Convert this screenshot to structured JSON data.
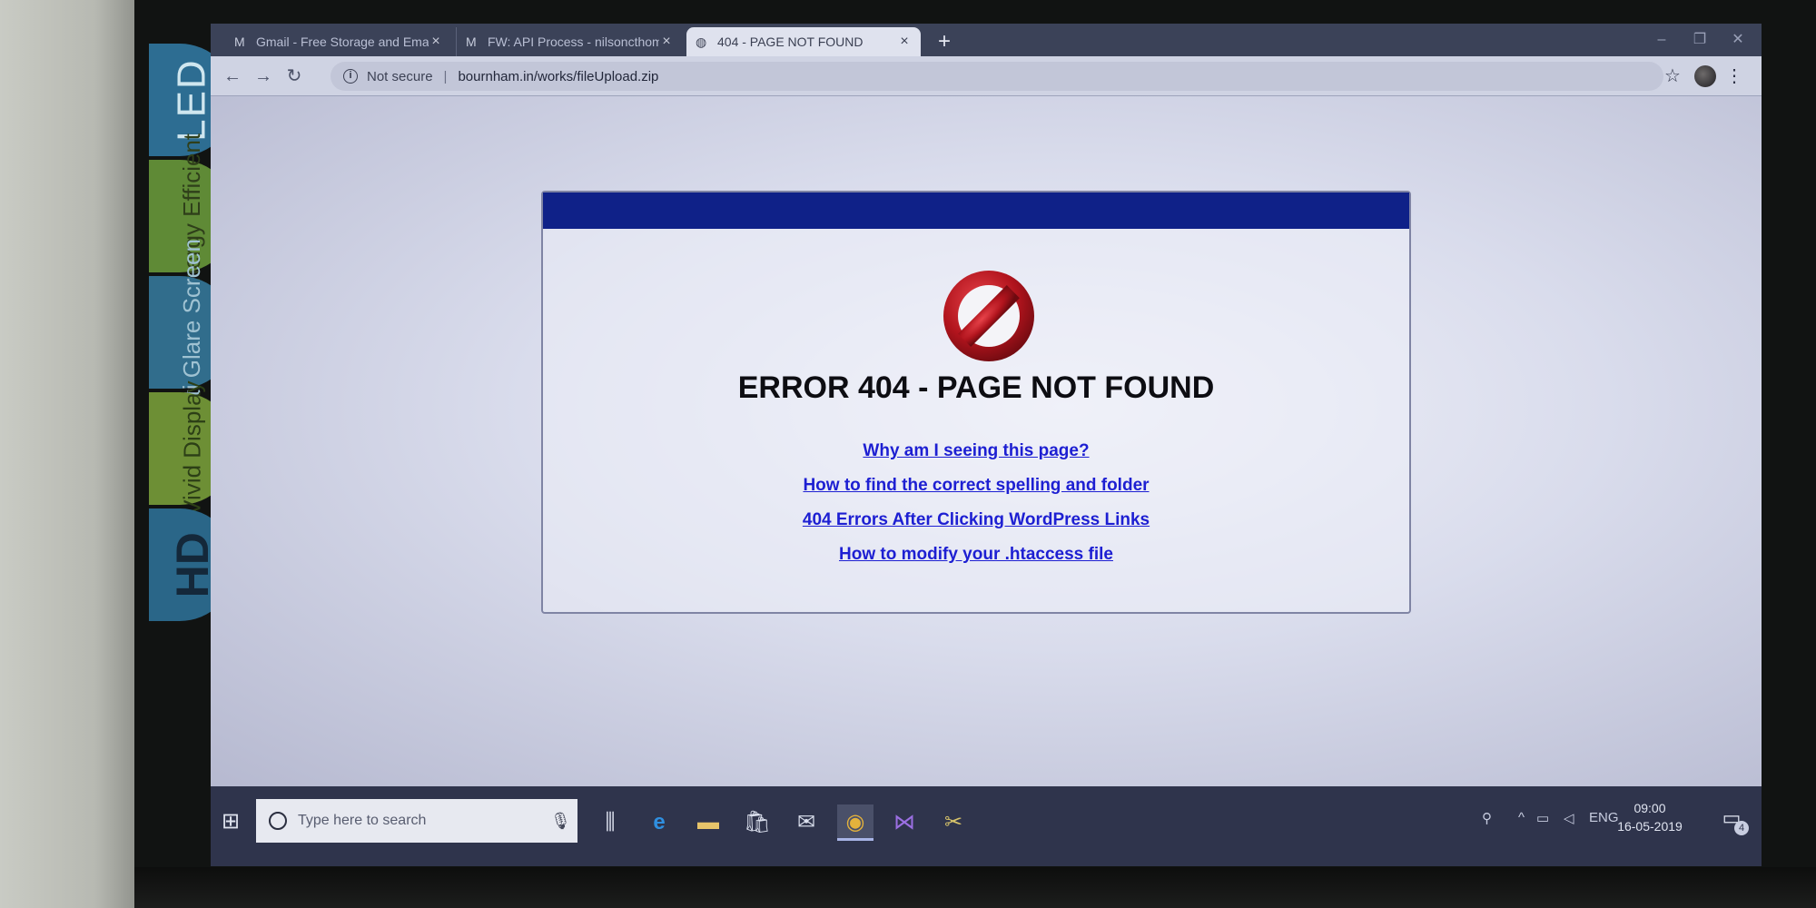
{
  "stickers": [
    "LED",
    "Energy Efficient",
    "Anti Glare Screen",
    "Vivid Display",
    "HD"
  ],
  "browser": {
    "tabs": [
      {
        "icon": "gmail-icon",
        "title": "Gmail - Free Storage and Email fr"
      },
      {
        "icon": "gmail-icon",
        "title": "FW: API Process - nilsoncthomas"
      },
      {
        "icon": "globe-icon",
        "title": "404 - PAGE NOT FOUND"
      }
    ],
    "new_tab": "+",
    "security_label": "Not secure",
    "url": "bournham.in/works/fileUpload.zip"
  },
  "page": {
    "header_color": "#0f2188",
    "error_title": "ERROR 404 - PAGE NOT FOUND",
    "links": [
      "Why am I seeing this page?",
      "How to find the correct spelling and folder",
      "404 Errors After Clicking WordPress Links",
      "How to modify your .htaccess file"
    ],
    "link_color": "#1d1fd2"
  },
  "taskbar": {
    "search_placeholder": "Type here to search",
    "apps": [
      "task-view-icon",
      "edge-icon",
      "file-explorer-icon",
      "store-icon",
      "mail-icon",
      "chrome-icon",
      "visual-studio-icon",
      "tool-icon"
    ],
    "language": "ENG",
    "time": "09:00",
    "date": "16-05-2019",
    "notification_count": "4"
  }
}
